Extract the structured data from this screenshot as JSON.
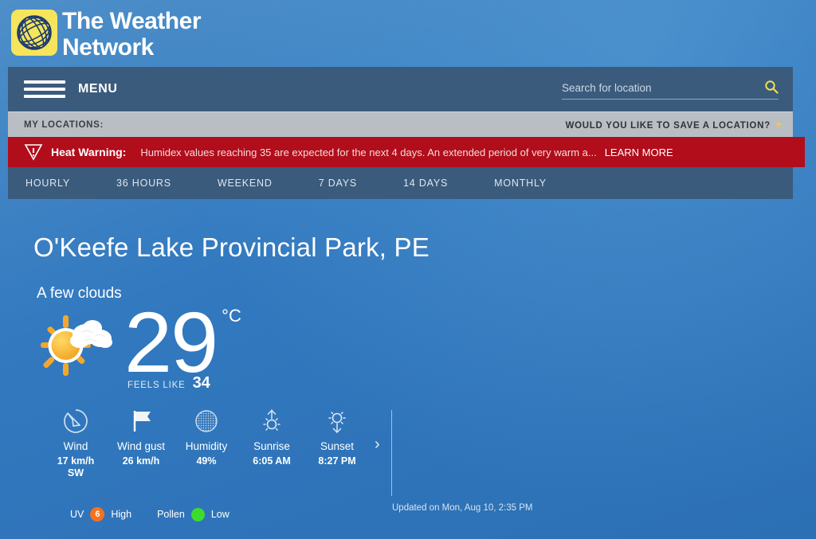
{
  "brand": {
    "name_line1": "The Weather",
    "name_line2": "Network",
    "logo_color": "#f5e45c"
  },
  "nav": {
    "menu_label": "MENU",
    "search_placeholder": "Search for location",
    "search_value": ""
  },
  "locations_bar": {
    "label": "MY LOCATIONS:",
    "save_prompt": "WOULD YOU LIKE TO SAVE A LOCATION?",
    "plus": "+"
  },
  "alert": {
    "title": "Heat Warning:",
    "text": "Humidex values reaching 35 are expected for the next 4 days. An extended period of very warm a...",
    "learn_more": "LEARN MORE",
    "color": "#b10d1b"
  },
  "tabs": [
    {
      "label": "HOURLY"
    },
    {
      "label": "36 HOURS"
    },
    {
      "label": "WEEKEND"
    },
    {
      "label": "7 DAYS"
    },
    {
      "label": "14 DAYS"
    },
    {
      "label": "MONTHLY"
    }
  ],
  "current": {
    "location": "O'Keefe Lake Provincial Park, PE",
    "condition": "A few clouds",
    "temperature": "29",
    "unit": "°C",
    "feels_like_label": "FEELS LIKE",
    "feels_like_value": "34",
    "icon": "sun-behind-cloud-icon"
  },
  "stats": [
    {
      "icon": "wind-direction-icon",
      "name": "Wind",
      "value": "17 km/h\nSW"
    },
    {
      "icon": "flag-icon",
      "name": "Wind gust",
      "value": "26 km/h"
    },
    {
      "icon": "humidity-icon",
      "name": "Humidity",
      "value": "49%"
    },
    {
      "icon": "sunrise-icon",
      "name": "Sunrise",
      "value": "6:05 AM"
    },
    {
      "icon": "sunset-icon",
      "name": "Sunset",
      "value": "8:27 PM"
    }
  ],
  "indices": {
    "uv_label": "UV",
    "uv_value": "6",
    "uv_rating": "High",
    "uv_color": "#f4721f",
    "pollen_label": "Pollen",
    "pollen_rating": "Low",
    "pollen_color": "#3ddb2c"
  },
  "updated": "Updated on Mon, Aug 10, 2:35 PM"
}
